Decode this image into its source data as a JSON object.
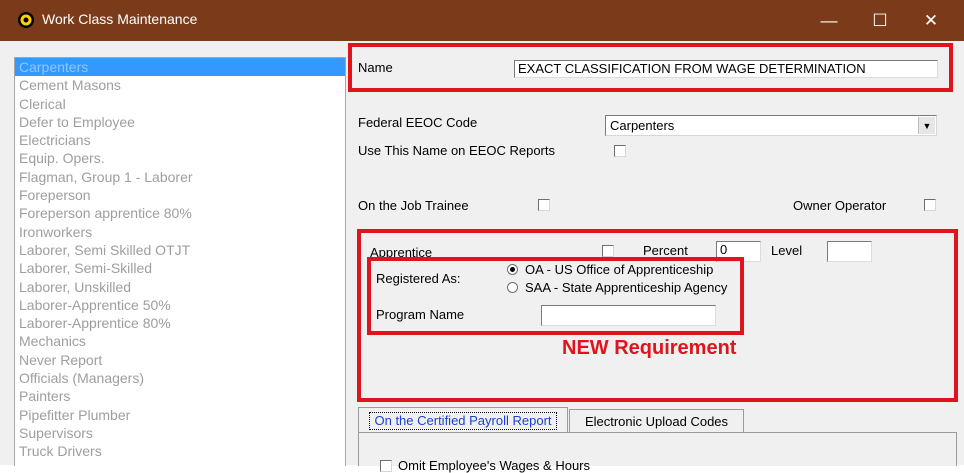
{
  "window": {
    "title": "Work Class Maintenance",
    "controls": {
      "minimize": "—",
      "maximize": "☐",
      "close": "✕"
    }
  },
  "work_classes": {
    "items": [
      "Carpenters",
      "Cement Masons",
      "Clerical",
      "Defer to Employee",
      "Electricians",
      "Equip. Opers.",
      "Flagman, Group 1 - Laborer",
      "Foreperson",
      "Foreperson apprentice 80%",
      "Ironworkers",
      "Laborer, Semi Skilled OTJT",
      "Laborer, Semi-Skilled",
      "Laborer, Unskilled",
      "Laborer-Apprentice 50%",
      "Laborer-Apprentice 80%",
      "Mechanics",
      "Never Report",
      "Officials (Managers)",
      "Painters",
      "Pipefitter Plumber",
      "Supervisors",
      "Truck Drivers"
    ],
    "selected": "Carpenters"
  },
  "form": {
    "name_label": "Name",
    "name_value": "EXACT CLASSIFICATION FROM WAGE DETERMINATION",
    "eeoc_label": "Federal EEOC Code",
    "eeoc_value": "Carpenters",
    "use_name_label": "Use This Name on EEOC Reports",
    "use_name_checked": false,
    "ojt_label": "On the Job Trainee",
    "ojt_checked": false,
    "owner_operator_label": "Owner Operator",
    "owner_operator_checked": false,
    "apprentice_label": "Apprentice",
    "apprentice_checked": false,
    "percent_label": "Percent",
    "percent_value": "0",
    "level_label": "Level",
    "level_value": "",
    "registered_as_label": "Registered As:",
    "registered_options": [
      {
        "label": "OA - US Office of Apprenticeship",
        "selected": true
      },
      {
        "label": "SAA - State Apprenticeship Agency",
        "selected": false
      }
    ],
    "program_name_label": "Program Name",
    "program_name_value": ""
  },
  "annotation": {
    "text": "NEW Requirement",
    "color": "#e0141e"
  },
  "tabs": [
    {
      "label": "On the Certified Payroll Report",
      "active": true
    },
    {
      "label": "Electronic Upload Codes",
      "active": false
    }
  ],
  "tab_content": {
    "first_row_partial": "Omit Employee's Wages & Hours"
  },
  "colors": {
    "titlebar": "#7b3a1a",
    "highlight_box": "#e0141e",
    "selection": "#3399ff",
    "active_tab_text": "#1a3fd6"
  },
  "icons": {
    "app": "sun-app-icon"
  }
}
